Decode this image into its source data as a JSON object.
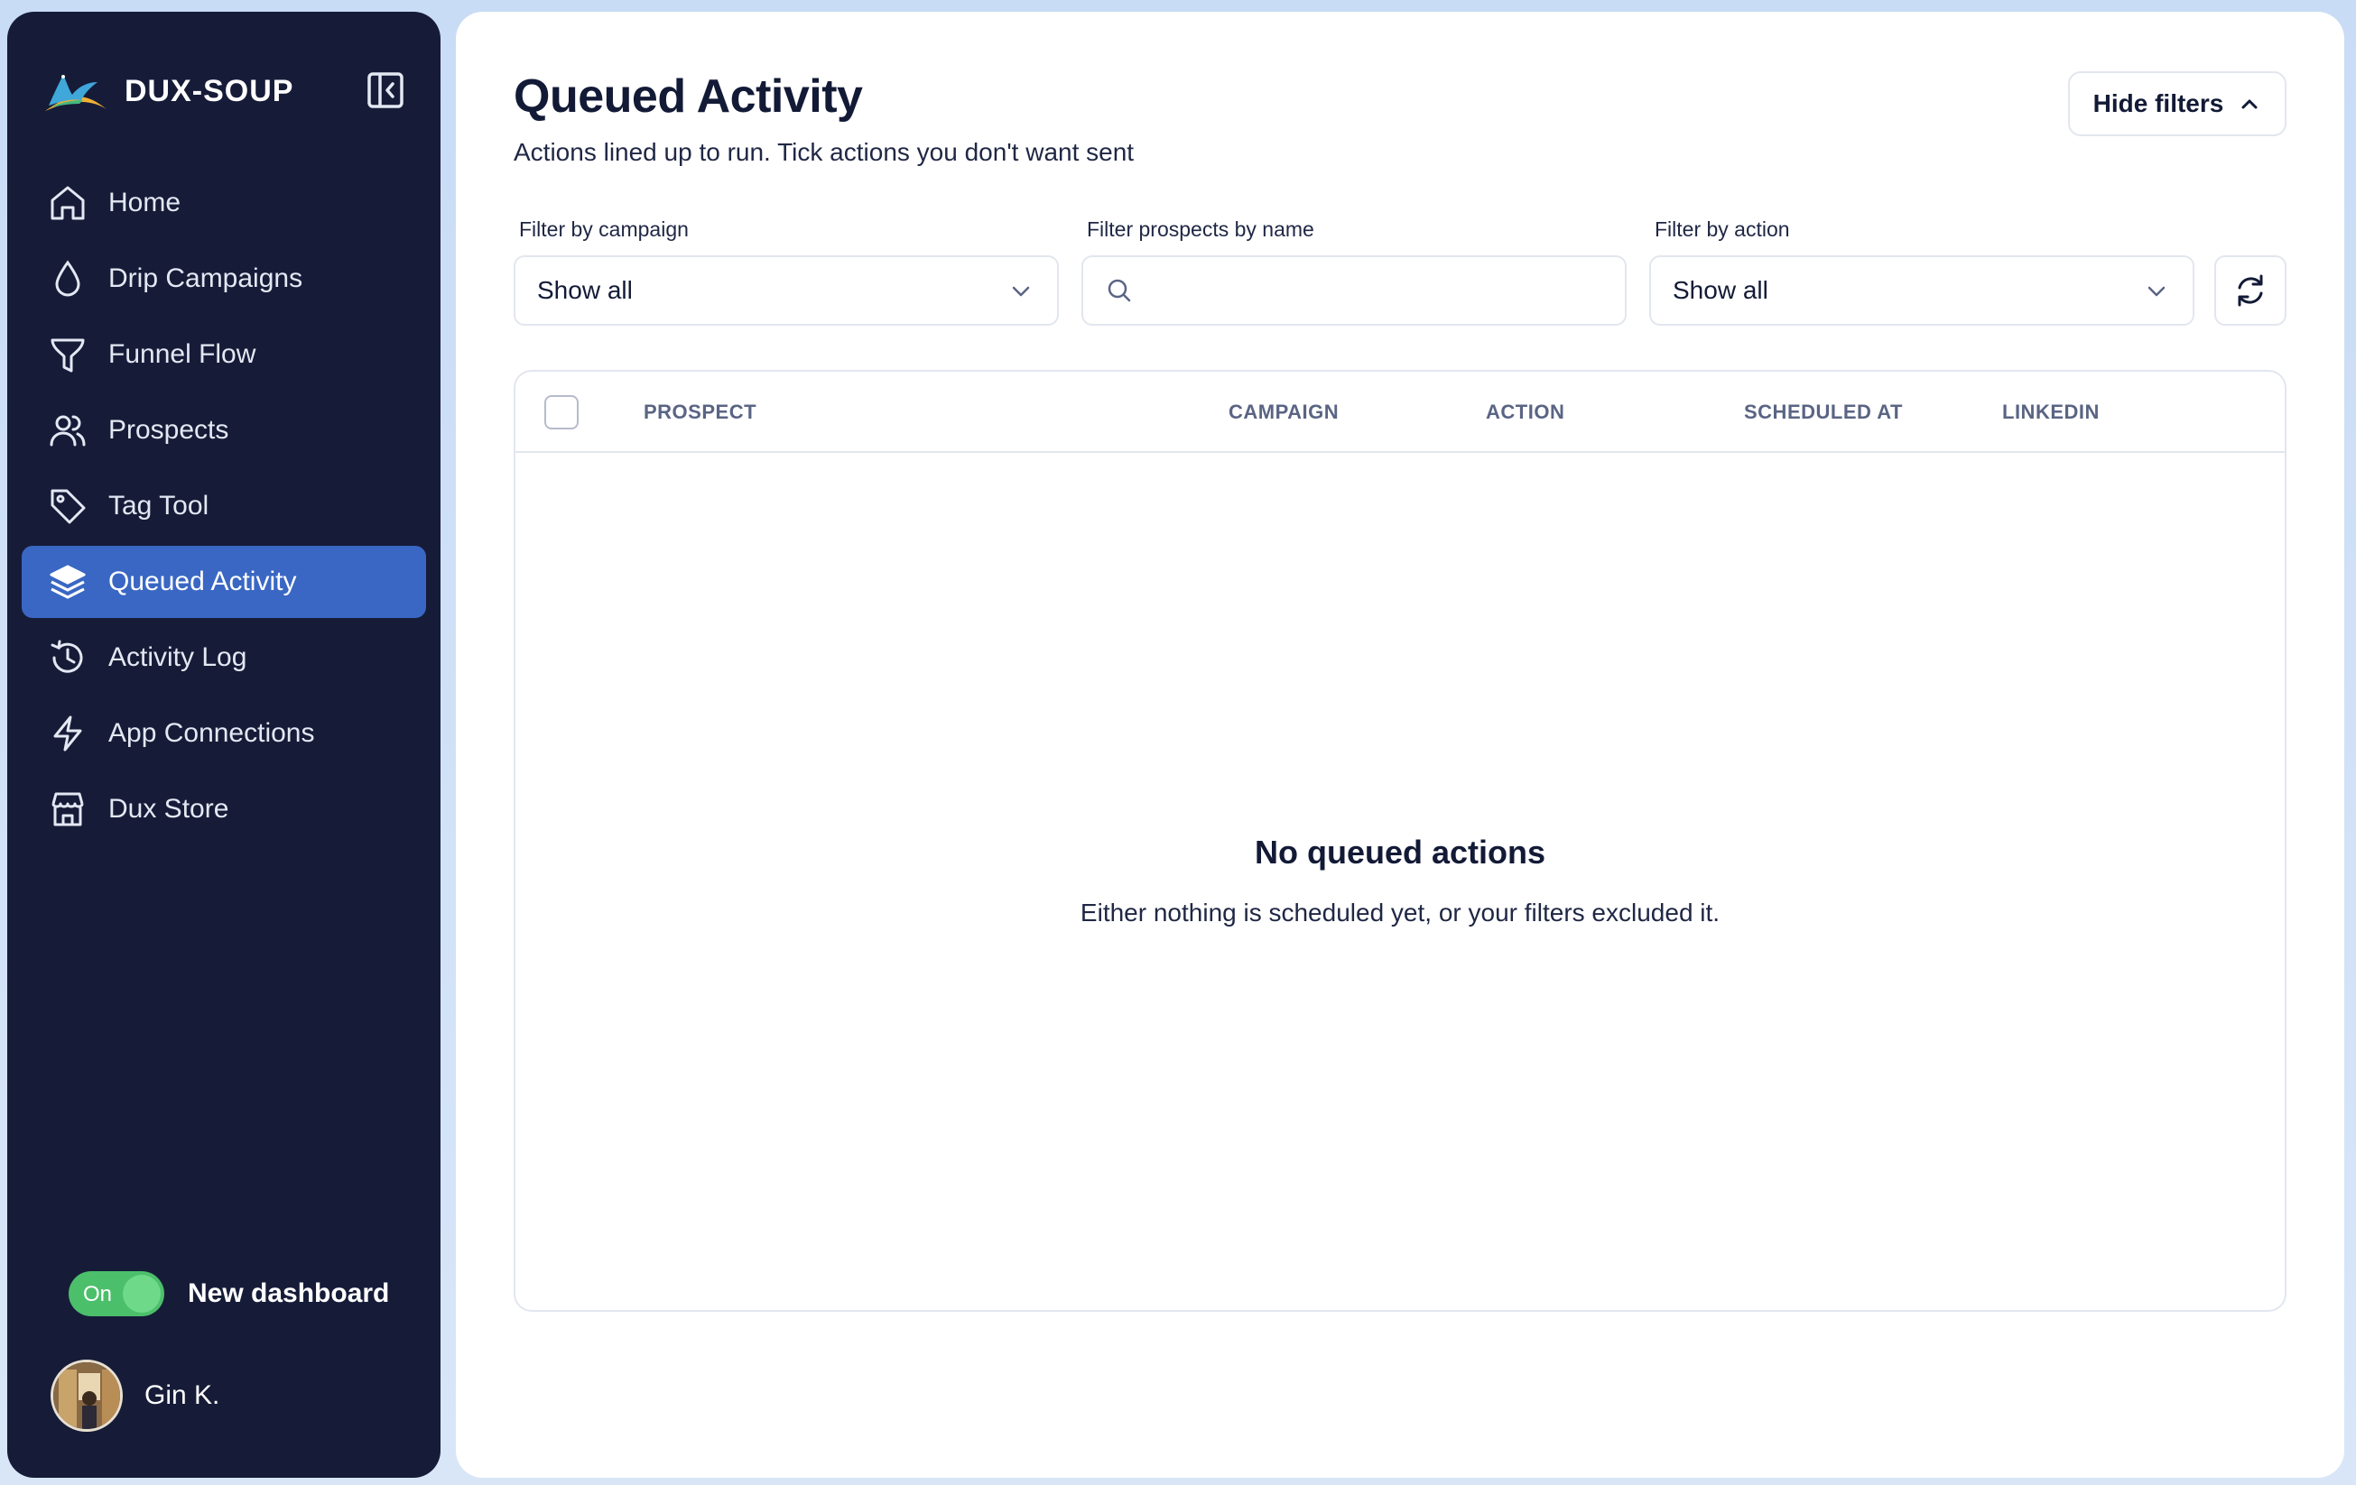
{
  "brand": {
    "name": "DUX-SOUP"
  },
  "sidebar": {
    "items": [
      {
        "label": "Home",
        "icon": "home-icon"
      },
      {
        "label": "Drip Campaigns",
        "icon": "drop-icon"
      },
      {
        "label": "Funnel Flow",
        "icon": "funnel-icon"
      },
      {
        "label": "Prospects",
        "icon": "users-icon"
      },
      {
        "label": "Tag Tool",
        "icon": "tag-icon"
      },
      {
        "label": "Queued Activity",
        "icon": "layers-icon",
        "active": true
      },
      {
        "label": "Activity Log",
        "icon": "history-icon"
      },
      {
        "label": "App Connections",
        "icon": "bolt-icon"
      },
      {
        "label": "Dux Store",
        "icon": "store-icon"
      }
    ],
    "toggle": {
      "state": "On",
      "label": "New dashboard"
    },
    "user": {
      "name": "Gin K."
    }
  },
  "header": {
    "title": "Queued Activity",
    "subtitle": "Actions lined up to run. Tick actions you don't want sent",
    "hide_filters_label": "Hide filters"
  },
  "filters": {
    "campaign": {
      "label": "Filter by campaign",
      "value": "Show all"
    },
    "name": {
      "label": "Filter prospects by name",
      "value": "",
      "placeholder": ""
    },
    "action": {
      "label": "Filter by action",
      "value": "Show all"
    }
  },
  "table": {
    "columns": [
      "PROSPECT",
      "CAMPAIGN",
      "ACTION",
      "SCHEDULED AT",
      "LINKEDIN"
    ],
    "rows": [],
    "empty_title": "No queued actions",
    "empty_subtitle": "Either nothing is scheduled yet, or your filters excluded it."
  },
  "colors": {
    "sidebar_bg": "#161c38",
    "active_nav": "#3a67c3",
    "toggle_on": "#4cbf6b",
    "page_bg": "#c9dcf6"
  }
}
